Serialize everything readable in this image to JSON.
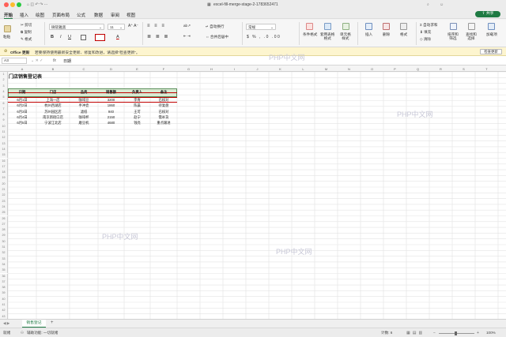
{
  "window": {
    "title": "excel-fill-merge-stage-2-1783652471",
    "share_label": "共享"
  },
  "menu": [
    "开始",
    "插入",
    "绘图",
    "页面布局",
    "公式",
    "数据",
    "审阅",
    "视图"
  ],
  "ribbon": {
    "paste": "粘贴",
    "clipboard": [
      "剪切",
      "复制",
      "格式"
    ],
    "font_name": "微软雅黑",
    "font_size": "11",
    "wrap": "自动换行",
    "merge": "合并后居中",
    "number_format": "常规",
    "cond_format": "条件格式",
    "table_format": "套用表格\n格式",
    "cell_style": "单元格\n样式",
    "insert": "插入",
    "delete": "删除",
    "format": "格式",
    "autosum": "自动求和",
    "fill": "填充",
    "clear": "清除",
    "sort_filter": "排序和\n筛选",
    "find_select": "查找和\n选择",
    "addins": "加载项"
  },
  "infobar": {
    "title": "Office 更新",
    "message": "若要保持使用最新安全更新、修复和改进，请选择“检查更新”。",
    "button": "检查更新"
  },
  "formula": {
    "namebox": "A3",
    "fx": "fx",
    "value": "日期"
  },
  "columns": [
    "A",
    "B",
    "C",
    "D",
    "E",
    "F",
    "G",
    "H",
    "I",
    "J",
    "K",
    "L",
    "M",
    "N",
    "O",
    "P",
    "Q",
    "R",
    "S",
    "T"
  ],
  "sheet": {
    "title": "门店销售登记表",
    "headers": [
      "日期",
      "门店",
      "品类",
      "销售额",
      "负责人",
      "备注"
    ],
    "rows": [
      [
        "6月1日",
        "上海一店",
        "咖啡豆",
        "3200",
        "李青",
        "已核对"
      ],
      [
        "6月2日",
        "杭州西湖店",
        "手冲壶",
        "1860",
        "陈晨",
        "待复盘"
      ],
      [
        "6月3日",
        "苏州园区店",
        "滤纸",
        "940",
        "王可",
        "已核对"
      ],
      [
        "6月4日",
        "南京新街口店",
        "咖啡杯",
        "2150",
        "赵宁",
        "需补货"
      ],
      [
        "6月5日",
        "宁波江北店",
        "磨豆机",
        "4680",
        "钱亮",
        "重点跟进"
      ]
    ]
  },
  "watermark": "PHP中文网",
  "tabs": {
    "active": "销售登记",
    "add": "+"
  },
  "status": {
    "left": "就绪",
    "access": "辅助功能: 一切就绪",
    "count": "计数: 6",
    "zoom": "100%"
  },
  "colors": {
    "accent": "#1e7a43",
    "header_fill": "#d9ead3",
    "header_border": "#5b8f5b",
    "strike_red": "#c00000"
  }
}
